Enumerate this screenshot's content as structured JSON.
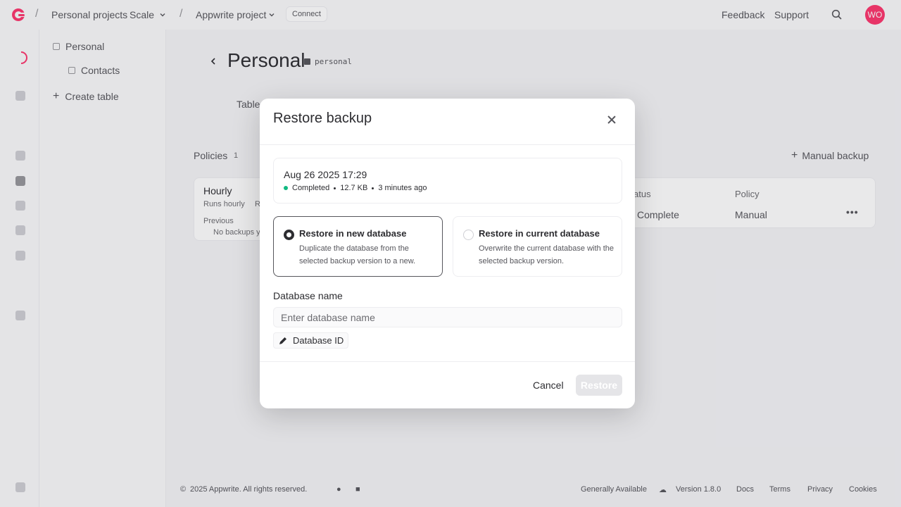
{
  "topbar": {
    "org_name": "Personal projects",
    "plan_badge": "Scale",
    "project_name": "Appwrite project",
    "connect_label": "Connect",
    "feedback_label": "Feedback",
    "support_label": "Support",
    "avatar_initials": "WO"
  },
  "sidebar": {
    "database_item": "Personal",
    "table_item": "Contacts",
    "create_table_label": "Create table"
  },
  "page": {
    "title": "Personal",
    "db_id": "personal",
    "tab_tables": "Table",
    "policies_label": "Policies",
    "policies_count": "1",
    "policy_name": "Hourly",
    "policy_runs": "Runs hourly",
    "policy_runs_extra": "R",
    "policy_previous_label": "Previous",
    "policy_previous_value": "No backups y",
    "manual_backup_label": "Manual backup",
    "col_status": "atus",
    "col_policy": "Policy",
    "row_status": "Complete",
    "row_policy": "Manual"
  },
  "footer": {
    "copyright": "2025 Appwrite. All rights reserved.",
    "status": "Generally Available",
    "version": "Version 1.8.0",
    "docs": "Docs",
    "terms": "Terms",
    "privacy": "Privacy",
    "cookies": "Cookies"
  },
  "modal": {
    "title": "Restore backup",
    "backup": {
      "date": "Aug 26 2025 17:29",
      "status": "Completed",
      "size": "12.7 KB",
      "age": "3 minutes ago"
    },
    "options": [
      {
        "title": "Restore in new database",
        "description": "Duplicate the database from the selected backup version to a new.",
        "selected": true
      },
      {
        "title": "Restore in current database",
        "description": "Overwrite the current database with the selected backup version.",
        "selected": false
      }
    ],
    "field_label": "Database name",
    "field_placeholder": "Enter database name",
    "field_value": "",
    "id_button_label": "Database ID",
    "cancel_label": "Cancel",
    "restore_label": "Restore"
  },
  "colors": {
    "brand": "#fd366e",
    "status_success": "#10b981",
    "disabled_button": "#e5e5e8"
  }
}
